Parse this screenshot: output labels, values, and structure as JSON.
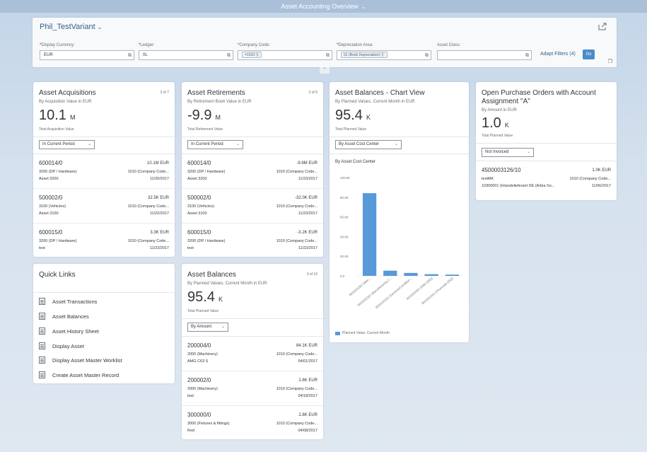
{
  "app": {
    "title": "Asset Accounting Overview"
  },
  "filter_bar": {
    "variant": "Phil_TestVariant",
    "fields": [
      {
        "label": "Display Currency:",
        "required": true,
        "value": "EUR"
      },
      {
        "label": "Ledger:",
        "required": true,
        "value": "0L"
      },
      {
        "label": "Company Code:",
        "required": true,
        "value": "",
        "token": "=1010"
      },
      {
        "label": "Depreciation Area:",
        "required": true,
        "value": "",
        "token": "01 (Book Depreciation)"
      },
      {
        "label": "Asset Class:",
        "required": false,
        "value": ""
      }
    ],
    "adapt_filters": "Adapt Filters (4)",
    "go": "Go"
  },
  "acquisitions": {
    "title": "Asset Acquisitions",
    "count": "3 of 7",
    "subtitle": "By Acquisition Value in EUR",
    "kpi_value": "10.1",
    "kpi_scale": "M",
    "kpi_label": "Total Acquisition Value",
    "filter": "In Current Period",
    "rows": [
      {
        "id": "600014/0",
        "amount": "10.1M EUR",
        "class": "3200 (DP / Hardware)",
        "company": "1010 (Company Code...",
        "desc": "Asset 3200",
        "date": "11/20/2017"
      },
      {
        "id": "500002/0",
        "amount": "32.5K EUR",
        "class": "3100 (Vehicles)",
        "company": "1010 (Company Code...",
        "desc": "Asset 3100",
        "date": "11/22/2017"
      },
      {
        "id": "600015/0",
        "amount": "3.3K EUR",
        "class": "3200 (DP / Hardware)",
        "company": "1010 (Company Code...",
        "desc": "test",
        "date": "11/23/2017"
      }
    ]
  },
  "retirements": {
    "title": "Asset Retirements",
    "count": "3 of 6",
    "subtitle": "By Retirement Book Value in EUR",
    "kpi_value": "-9.9",
    "kpi_scale": "M",
    "kpi_label": "Total Retirement Value",
    "filter": "In Current Period",
    "rows": [
      {
        "id": "600014/0",
        "amount": "-9.8M EUR",
        "class": "3200 (DP / Hardware)",
        "company": "1010 (Company Code...",
        "desc": "Asset 3200",
        "date": "11/23/2017"
      },
      {
        "id": "500002/0",
        "amount": "-32.0K EUR",
        "class": "3100 (Vehicles)",
        "company": "1010 (Company Code...",
        "desc": "Asset 3100",
        "date": "11/23/2017"
      },
      {
        "id": "600015/0",
        "amount": "-3.2K EUR",
        "class": "3200 (DP / Hardware)",
        "company": "1010 (Company Code...",
        "desc": "test",
        "date": "11/23/2017"
      }
    ]
  },
  "balances_chart": {
    "title": "Asset Balances - Chart View",
    "subtitle": "By Planned Values, Current Month in EUR",
    "kpi_value": "95.4",
    "kpi_scale": "K",
    "kpi_label": "Total Planned Value",
    "filter": "By Asset Cost Center",
    "chart_title": "By Asset Cost Center",
    "legend": "Planned Value, Current Month"
  },
  "chart_data": {
    "type": "bar",
    "title": "By Asset Cost Center",
    "categories": [
      "0010101302 (Man...",
      "0010101301 (Manufacturing 1...",
      "0010101321 (Services/Condition...",
      "0010101501 (R&D (DE))",
      "0010101101 (Financials (DE))"
    ],
    "series": [
      {
        "name": "Planned Value, Current Month",
        "values": [
          84.1,
          5.3,
          3.0,
          1.7,
          1.3
        ]
      }
    ],
    "ylim": [
      0,
      100
    ],
    "yticks": [
      "0.0",
      "20.0K",
      "40.0K",
      "60.0K",
      "80.0K",
      "100.0K"
    ],
    "color": "#5899da",
    "grid": false,
    "legend_position": "bottom"
  },
  "purchase_orders": {
    "title": "Open Purchase Orders with Account Assignment \"A\"",
    "subtitle": "By Amount in EUR",
    "kpi_value": "1.0",
    "kpi_scale": "K",
    "kpi_label": "Total Planned Value",
    "filter": "Not Invoiced",
    "rows": [
      {
        "id": "4500003126/10",
        "amount": "1.0K EUR",
        "class": "testMK",
        "company": "1010 (Company Code...",
        "desc": "10300001 (Inlandslieferant DE (Ariba So...",
        "date": "11/06/2017"
      }
    ]
  },
  "quick_links": {
    "title": "Quick Links",
    "items": [
      "Asset Transactions",
      "Asset Balances",
      "Asset History Sheet",
      "Display Asset",
      "Display Asset Master Worklist",
      "Create Asset Master Record"
    ]
  },
  "balances": {
    "title": "Asset Balances",
    "count": "3 of 10",
    "subtitle": "By Planned Values, Current Month in EUR",
    "kpi_value": "95.4",
    "kpi_scale": "K",
    "kpi_label": "Total Planned Value",
    "filter": "By Amount",
    "rows": [
      {
        "id": "200004/0",
        "amount": "84.1K EUR",
        "class": "2000 (Machinery)",
        "company": "1010 (Company Code...",
        "desc": "AMG C63 S",
        "date": "04/01/2017"
      },
      {
        "id": "200002/0",
        "amount": "2.8K EUR",
        "class": "2000 (Machinery)",
        "company": "1010 (Company Code...",
        "desc": "test",
        "date": "04/18/2017"
      },
      {
        "id": "300000/0",
        "amount": "2.8K EUR",
        "class": "3000 (Fixtures & fittings)",
        "company": "1010 (Company Code...",
        "desc": "Red",
        "date": "04/08/2017"
      }
    ]
  }
}
